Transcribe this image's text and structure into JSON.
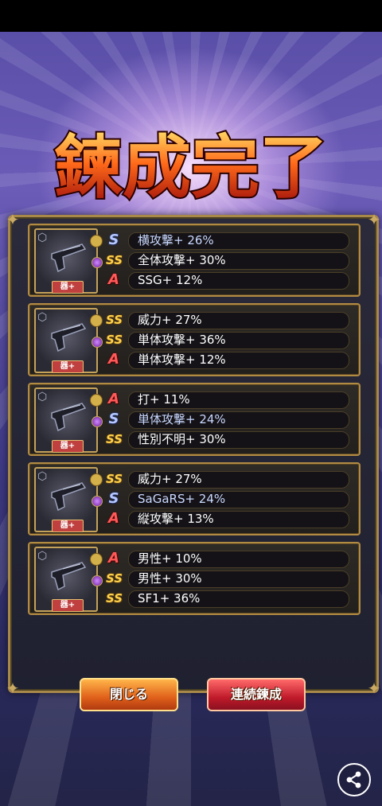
{
  "title": "鍊成完了",
  "items": [
    {
      "tag": "器+",
      "stats": [
        {
          "rank": "S",
          "text": "横攻撃+ 26%"
        },
        {
          "rank": "SS",
          "text": "全体攻撃+ 30%"
        },
        {
          "rank": "A",
          "text": "SSG+ 12%"
        }
      ]
    },
    {
      "tag": "器+",
      "stats": [
        {
          "rank": "SS",
          "text": "威力+ 27%"
        },
        {
          "rank": "SS",
          "text": "単体攻撃+ 36%"
        },
        {
          "rank": "A",
          "text": "単体攻撃+ 12%"
        }
      ]
    },
    {
      "tag": "器+",
      "stats": [
        {
          "rank": "A",
          "text": "打+ 11%"
        },
        {
          "rank": "S",
          "text": "単体攻撃+ 24%"
        },
        {
          "rank": "SS",
          "text": "性別不明+ 30%"
        }
      ]
    },
    {
      "tag": "器+",
      "stats": [
        {
          "rank": "SS",
          "text": "威力+ 27%"
        },
        {
          "rank": "S",
          "text": "SaGaRS+ 24%"
        },
        {
          "rank": "A",
          "text": "縦攻撃+ 13%"
        }
      ]
    },
    {
      "tag": "器+",
      "stats": [
        {
          "rank": "A",
          "text": "男性+ 10%"
        },
        {
          "rank": "SS",
          "text": "男性+ 30%"
        },
        {
          "rank": "SS",
          "text": "SF1+ 36%"
        }
      ]
    }
  ],
  "buttons": {
    "close": "閉じる",
    "continue": "連続鍊成"
  },
  "colors": {
    "rank_S": "#b6c8ff",
    "rank_SS": "#ffd24a",
    "rank_A": "#ff5a5a",
    "frame": "#b28b43"
  },
  "icons": {
    "share": "share-icon"
  }
}
